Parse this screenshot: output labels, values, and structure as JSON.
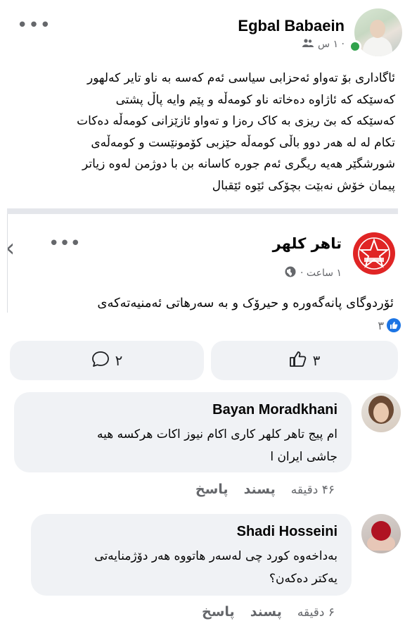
{
  "post": {
    "author": "Egbal Babaein",
    "time": "١ س ·",
    "audience_icon": "friends-icon",
    "more": "•••",
    "lines": [
      "ئاگاداری بۆ تەواو ئەحزابی سیاسی ئەم کەسە بە ناو تایر کەلهور",
      "کەسێکە کە ئاژاوە دەخاتە ناو  کومەڵە و پێم وایە پاڵ پشتی",
      "کەسێکە کە بێ ریزی بە کاک رەزا و تەواو ئازێزانی کومەڵە دەکات",
      "تکام لە  لە هەر دوو باڵی  کومەڵە حێزبی کۆمونێست و کومەڵەی",
      "شورشگێر  هەیە ریگری ئەم جورە کاسانە بن با دوژمن لەوە زیاتر",
      "پیمان خۆش نەبێت بچۆکی ئێوە ئێقبال"
    ]
  },
  "shared": {
    "name": "تاهر کلهر",
    "time": "١ ساعت ·",
    "globe_icon": "globe-icon",
    "text": "ئۆردوگای پانەگەورە و حیرۆک و بە سەرهاتی ئەمنیەتەکەی",
    "brand_color": "#e02525"
  },
  "reactions": {
    "count": "٣",
    "like_label": "٣",
    "comment_label": "٢"
  },
  "comments": [
    {
      "author": "Bayan Moradkhani",
      "lines": [
        "ام پیج تاهر کلهر کاری اکام نیوز اکات هرکسه هیه",
        "جاشی ایران ا"
      ],
      "time": "۴۶ دقیقه",
      "like": "پسند",
      "reply": "پاسخ"
    },
    {
      "author": "Shadi Hosseini",
      "lines": [
        "بەداخەوە کورد چی لەسەر هاتووە هەر دۆژمنایەتی",
        "یەکتر دەکەن؟"
      ],
      "time": "۶ دقیقه",
      "like": "پسند",
      "reply": "پاسخ"
    }
  ],
  "colors": {
    "online": "#31a24c",
    "like_blue": "#1b74e4",
    "button_bg": "#f0f2f5"
  }
}
